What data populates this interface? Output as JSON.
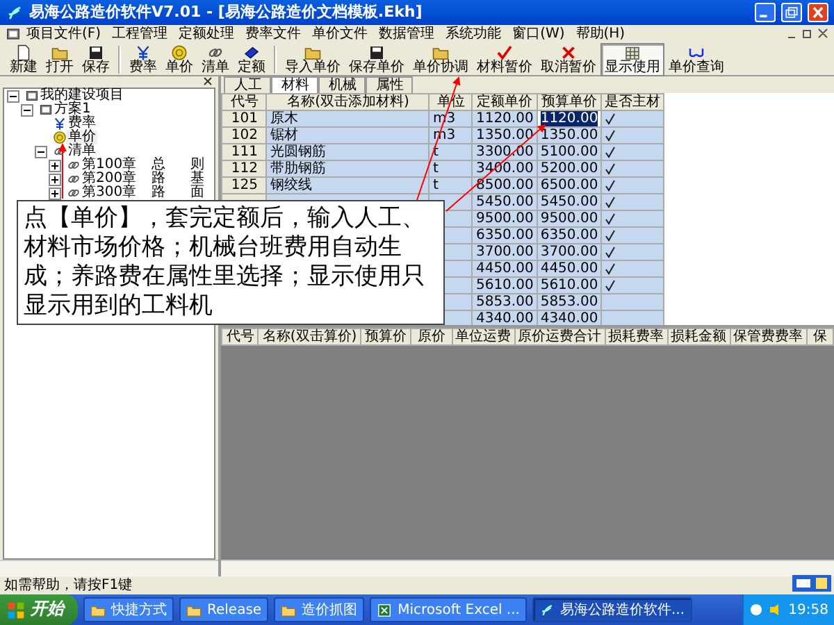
{
  "window": {
    "title": "易海公路造价软件V7.01 - [易海公路造价文档模板.Ekh]"
  },
  "menu": [
    "项目文件(F)",
    "工程管理",
    "定额处理",
    "费率文件",
    "单价文件",
    "数据管理",
    "系统功能",
    "窗口(W)",
    "帮助(H)"
  ],
  "toolbar": [
    {
      "label": "新建",
      "kind": "new",
      "pressed": false
    },
    {
      "label": "打开",
      "kind": "open",
      "pressed": false
    },
    {
      "label": "保存",
      "kind": "save",
      "pressed": false
    },
    {
      "label": "费率",
      "kind": "rate",
      "pressed": false
    },
    {
      "label": "单价",
      "kind": "coin",
      "pressed": false
    },
    {
      "label": "清单",
      "kind": "chain",
      "pressed": false
    },
    {
      "label": "定额",
      "kind": "book",
      "pressed": false
    },
    {
      "label": "导入单价",
      "kind": "open",
      "pressed": false
    },
    {
      "label": "保存单价",
      "kind": "save",
      "pressed": false
    },
    {
      "label": "单价协调",
      "kind": "open",
      "pressed": false
    },
    {
      "label": "材料暂价",
      "kind": "check",
      "pressed": false
    },
    {
      "label": "取消暂价",
      "kind": "cross",
      "pressed": false
    },
    {
      "label": "显示使用",
      "kind": "grid",
      "pressed": true
    },
    {
      "label": "单价查询",
      "kind": "glasses",
      "pressed": false
    }
  ],
  "tree": [
    {
      "label": "我的建设项目",
      "kind": "project",
      "expanded": true,
      "children": [
        {
          "label": "方案1",
          "kind": "project",
          "expanded": true,
          "children": [
            {
              "label": "费率",
              "kind": "rate",
              "selected": false
            },
            {
              "label": "单价",
              "kind": "coin",
              "selected": true
            },
            {
              "label": "清单",
              "kind": "chain",
              "expanded": true,
              "children": [
                {
                  "label": "第100章",
                  "columns": [
                    "总",
                    "则"
                  ],
                  "kind": "chain",
                  "expanded": false
                },
                {
                  "label": "第200章",
                  "columns": [
                    "路",
                    "基"
                  ],
                  "kind": "chain",
                  "expanded": false
                },
                {
                  "label": "第300章",
                  "columns": [
                    "路",
                    "面"
                  ],
                  "kind": "chain",
                  "expanded": false
                }
              ]
            }
          ]
        }
      ]
    }
  ],
  "tabs": [
    {
      "label": "人工",
      "selected": false
    },
    {
      "label": "材料",
      "selected": true
    },
    {
      "label": "机械",
      "selected": false
    },
    {
      "label": "属性",
      "selected": false
    }
  ],
  "material_table": {
    "columns": [
      "代号",
      "名称(双击添加材料)",
      "单位",
      "定额单价",
      "预算单价",
      "是否主材"
    ],
    "rows": [
      {
        "code": "101",
        "name": "原木",
        "unit": "m3",
        "quota_price": "1120.00",
        "budget_price": "1120.00",
        "main_material": true,
        "editing": true
      },
      {
        "code": "102",
        "name": "锯材",
        "unit": "m3",
        "quota_price": "1350.00",
        "budget_price": "1350.00",
        "main_material": true,
        "editing": false
      },
      {
        "code": "111",
        "name": "光圆钢筋",
        "unit": "t",
        "quota_price": "3300.00",
        "budget_price": "5100.00",
        "main_material": true,
        "editing": false
      },
      {
        "code": "112",
        "name": "带肋钢筋",
        "unit": "t",
        "quota_price": "3400.00",
        "budget_price": "5200.00",
        "main_material": true,
        "editing": false
      },
      {
        "code": "125",
        "name": "钢绞线",
        "unit": "t",
        "quota_price": "8500.00",
        "budget_price": "6500.00",
        "main_material": true,
        "editing": false
      },
      {
        "quota_price": "5450.00",
        "budget_price": "5450.00",
        "main_material": true,
        "editing": false
      },
      {
        "quota_price": "9500.00",
        "budget_price": "9500.00",
        "main_material": true,
        "editing": false
      },
      {
        "quota_price": "6350.00",
        "budget_price": "6350.00",
        "main_material": true,
        "editing": false
      },
      {
        "quota_price": "3700.00",
        "budget_price": "3700.00",
        "main_material": true,
        "editing": false
      },
      {
        "quota_price": "4450.00",
        "budget_price": "4450.00",
        "main_material": true,
        "editing": false
      },
      {
        "quota_price": "5610.00",
        "budget_price": "5610.00",
        "main_material": true,
        "editing": false
      },
      {
        "quota_price": "5853.00",
        "budget_price": "5853.00",
        "main_material": false,
        "editing": false
      },
      {
        "quota_price": "4340.00",
        "budget_price": "4340.00",
        "main_material": false,
        "editing": false
      }
    ]
  },
  "cost_table": {
    "columns": [
      "代号",
      "名称(双击算价)",
      "预算价",
      "原价",
      "单位运费",
      "原价运费合计",
      "损耗费率",
      "损耗金额",
      "保管费费率",
      "保"
    ]
  },
  "callout": {
    "text": "点【单价】，套完定额后，输入人工、材料市场价格；机械台班费用自动生成；养路费在属性里选择；显示使用只显示用到的工料机"
  },
  "status_bar": {
    "text": "如需帮助，请按F1键"
  },
  "taskbar": {
    "start": "开始",
    "items": [
      {
        "label": "快捷方式",
        "kind": "folder",
        "active": false
      },
      {
        "label": "Release",
        "kind": "folder",
        "active": false
      },
      {
        "label": "造价抓图",
        "kind": "folder",
        "active": false
      },
      {
        "label": "Microsoft Excel ...",
        "kind": "excel",
        "active": false
      },
      {
        "label": "易海公路造价软件...",
        "kind": "app",
        "active": true
      }
    ],
    "clock": "19:58"
  }
}
